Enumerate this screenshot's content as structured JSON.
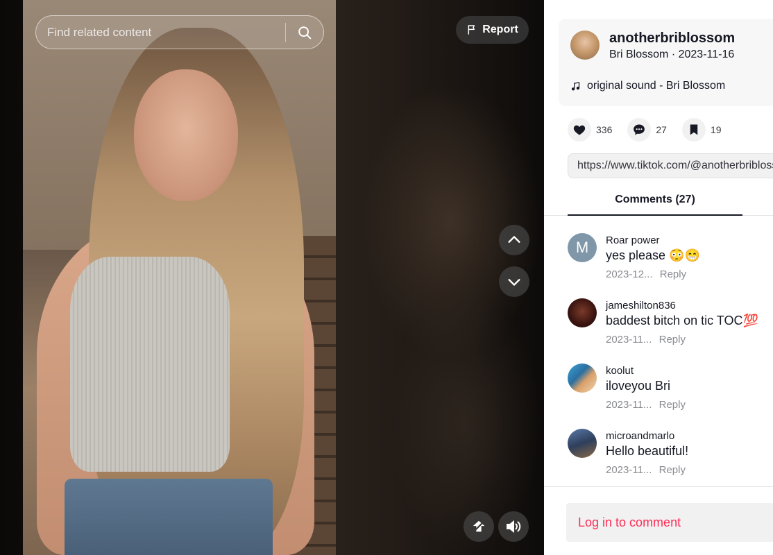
{
  "search": {
    "placeholder": "Find related content"
  },
  "report": {
    "label": "Report"
  },
  "author": {
    "username": "anotherbriblossom",
    "display_name": "Bri Blossom",
    "date": "2023-11-16",
    "meta_separator": "·",
    "sound": "original sound - Bri Blossom"
  },
  "actions": {
    "likes": "336",
    "comments": "27",
    "saves": "19"
  },
  "link": {
    "url": "https://www.tiktok.com/@anotherbriblossom"
  },
  "tabs": {
    "comments_label": "Comments (27)"
  },
  "comments": [
    {
      "user": "Roar power",
      "text": "yes please 😳😁",
      "date": "2023-12...",
      "reply": "Reply",
      "avatar_letter": "M"
    },
    {
      "user": "jameshilton836",
      "text": "baddest bitch on tic TOC💯",
      "date": "2023-11...",
      "reply": "Reply"
    },
    {
      "user": "koolut",
      "text": "iloveyou Bri",
      "date": "2023-11...",
      "reply": "Reply"
    },
    {
      "user": "microandmarlo",
      "text": "Hello beautiful!",
      "date": "2023-11...",
      "reply": "Reply"
    }
  ],
  "login": {
    "label": "Log in to comment"
  },
  "colors": {
    "accent": "#fe2c55",
    "text": "#161823",
    "muted": "#8a8b91"
  },
  "icons": {
    "search": "search-icon",
    "report": "flag-icon",
    "up": "chevron-up-icon",
    "down": "chevron-down-icon",
    "pip": "floating-player-icon",
    "volume": "volume-icon",
    "like": "heart-icon",
    "comment": "comment-icon",
    "save": "bookmark-icon",
    "sound": "music-note-icon"
  }
}
